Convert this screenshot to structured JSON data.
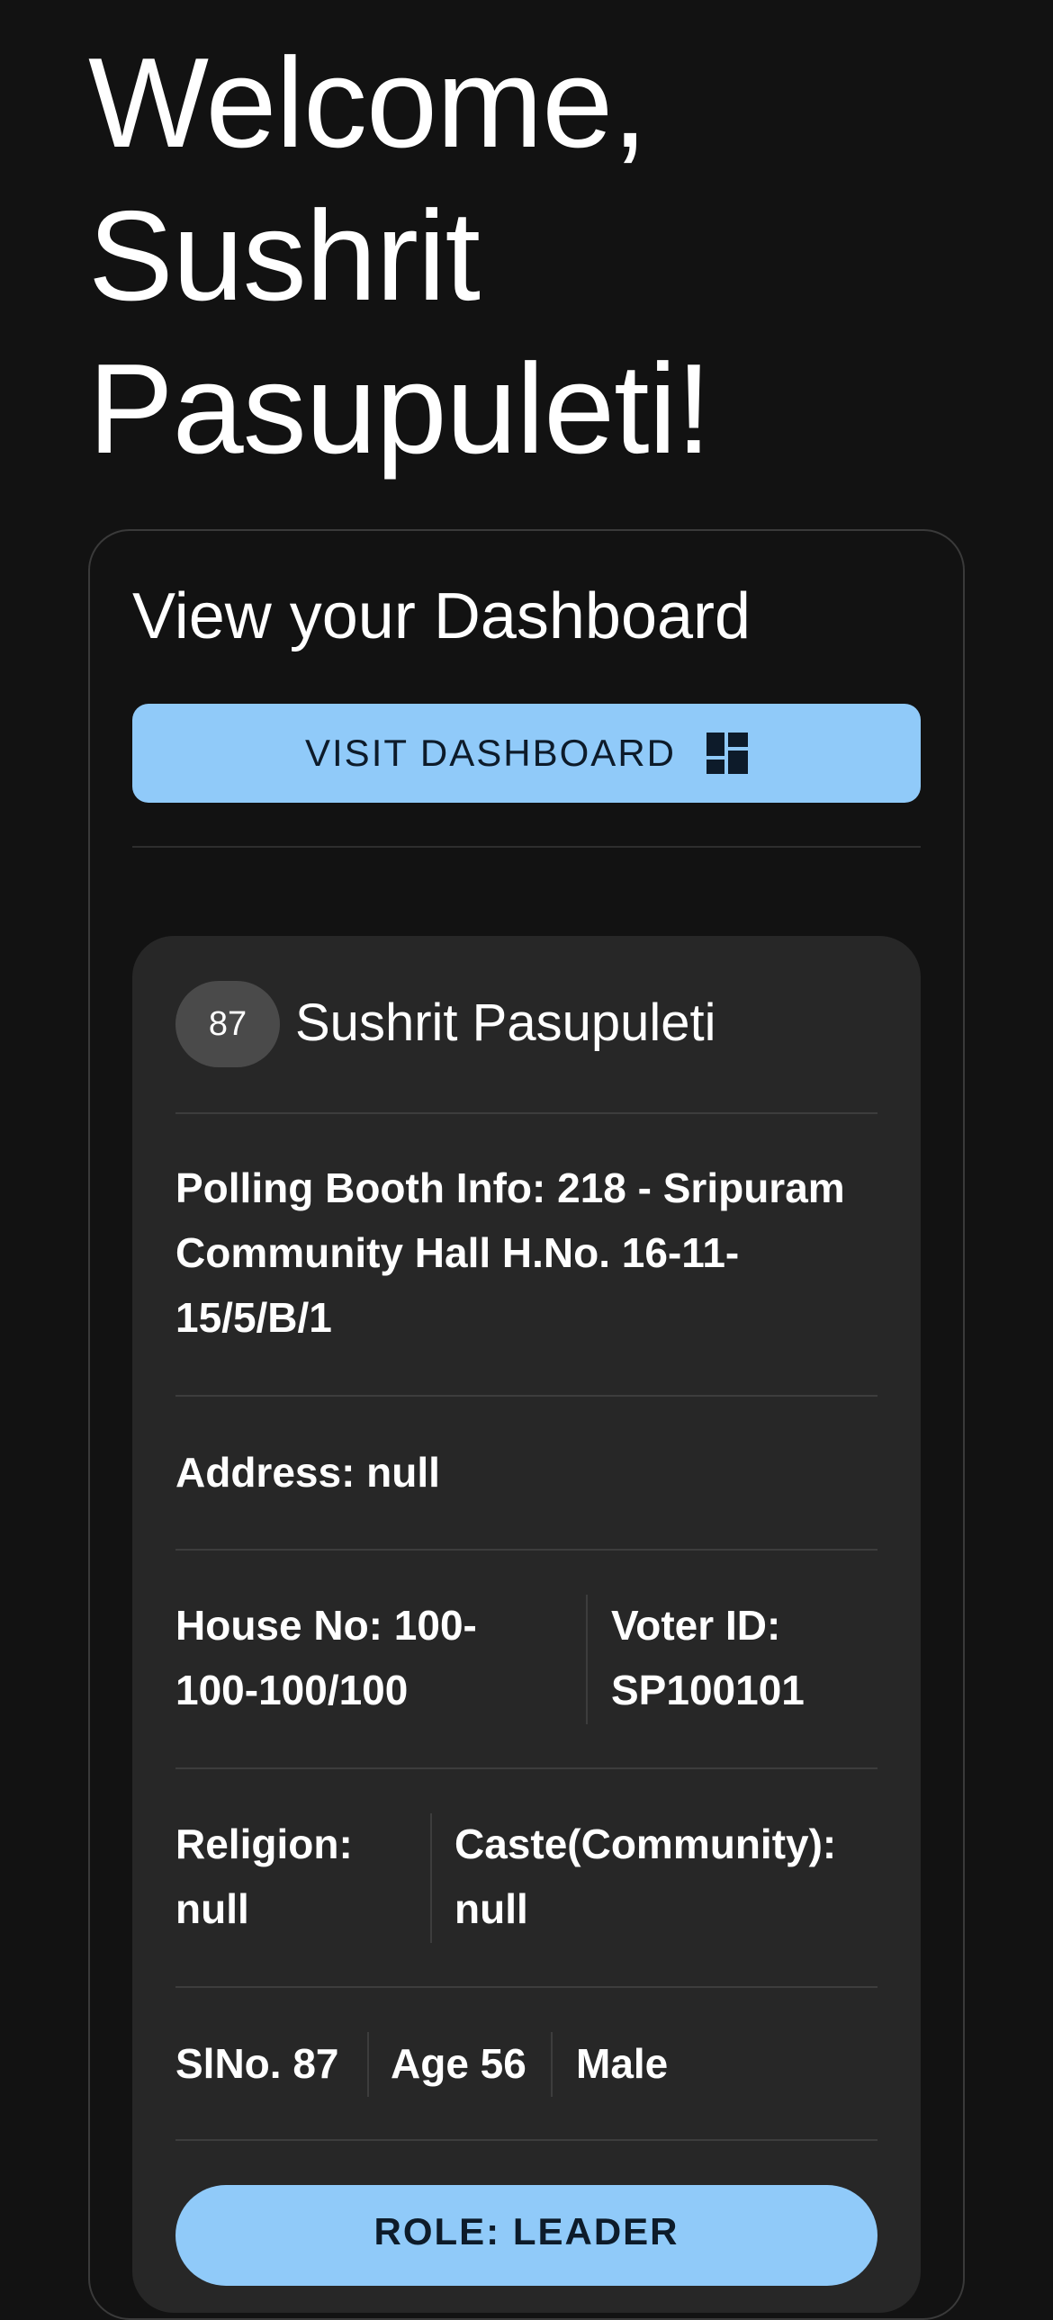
{
  "greeting": {
    "line1": "Welcome,",
    "line2": "Sushrit",
    "line3": "Pasupuleti!"
  },
  "dashboard_card": {
    "title": "View your Dashboard",
    "button_label": "VISIT DASHBOARD",
    "button_icon": "dashboard-icon"
  },
  "voter": {
    "avatar_text": "87",
    "name": "Sushrit Pasupuleti",
    "polling_booth_line1": "Polling Booth Info: 218 - Sripuram",
    "polling_booth_line2": "Community Hall H.No. 16-11-",
    "polling_booth_line3": "15/5/B/1",
    "address": "Address: null",
    "house_no_line1": "House No: 100-",
    "house_no_line2": "100-100/100",
    "voter_id_line1": "Voter ID:",
    "voter_id_line2": "SP100101",
    "religion_line1": "Religion:",
    "religion_line2": "null",
    "caste_line1": "Caste(Community):",
    "caste_line2": "null",
    "slno": "SlNo. 87",
    "age": "Age 56",
    "gender": "Male",
    "role_label": "ROLE: LEADER"
  },
  "colors": {
    "background": "#121212",
    "card": "#272727",
    "accent": "#90caf9",
    "button_text": "#0d1b2a"
  }
}
